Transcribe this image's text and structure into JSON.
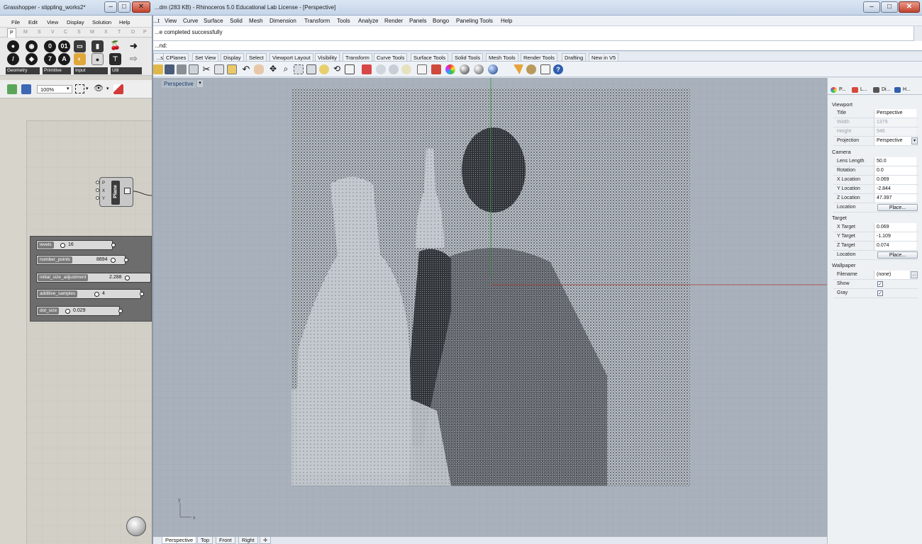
{
  "rhino": {
    "title": "...dm (283 KB) - Rhinoceros 5.0 Educational Lab License - [Perspective]",
    "menu": [
      "...t",
      "View",
      "Curve",
      "Surface",
      "Solid",
      "Mesh",
      "Dimension",
      "Transform",
      "Tools",
      "Analyze",
      "Render",
      "Panels",
      "Bongo",
      "Paneling Tools",
      "Help"
    ],
    "command_history": "...e completed successfully",
    "command_prompt": "...nd:",
    "toolbar_tabs": [
      "...s",
      "CPlanes",
      "Set View",
      "Display",
      "Select",
      "Viewport Layout",
      "Visibility",
      "Transform",
      "Curve Tools",
      "Surface Tools",
      "Solid Tools",
      "Mesh Tools",
      "Render Tools",
      "Drafting",
      "New in V5"
    ],
    "toolbar_icons": [
      "open-icon",
      "save-icon",
      "print-icon",
      "import-icon",
      "cut-icon",
      "copy-icon",
      "paste-icon",
      "undo-icon",
      "pan-icon",
      "move-icon",
      "zoom-icon",
      "zoom-window-icon",
      "zoom-extents-icon",
      "zoom-selected-icon",
      "rotate-view-icon",
      "four-viewports-icon",
      "show-points-icon",
      "hide-icon",
      "lock-icon",
      "lightbulb-icon",
      "layer-icon",
      "material-icon",
      "color-icon",
      "render-icon",
      "shaded-icon",
      "rendered-icon",
      "filter-icon",
      "settings-icon",
      "grid-snap-icon",
      "help-icon"
    ],
    "viewport": {
      "label": "Perspective",
      "tabs": [
        "Perspective",
        "Top",
        "Front",
        "Right"
      ],
      "axis_y": "y",
      "axis_x": "x"
    },
    "properties": {
      "tabs": [
        "P...",
        "L...",
        "Di...",
        "H..."
      ],
      "viewport_section": "Viewport",
      "title_label": "Title",
      "title_value": "Perspective",
      "width_label": "Width",
      "width_value": "1379",
      "height_label": "Height",
      "height_value": "946",
      "projection_label": "Projection",
      "projection_value": "Perspective",
      "camera_section": "Camera",
      "lens_label": "Lens Length",
      "lens_value": "50.0",
      "rotation_label": "Rotation",
      "rotation_value": "0.0",
      "xloc_label": "X Location",
      "xloc_value": "0.069",
      "yloc_label": "Y Location",
      "yloc_value": "-2.844",
      "zloc_label": "Z Location",
      "zloc_value": "47.397",
      "location_label": "Location",
      "place_label": "Place...",
      "target_section": "Target",
      "xt_label": "X Target",
      "xt_value": "0.069",
      "yt_label": "Y Target",
      "yt_value": "-1.109",
      "zt_label": "Z Target",
      "zt_value": "0.074",
      "tloc_label": "Location",
      "tplace_label": "Place...",
      "wallpaper_section": "Wallpaper",
      "filename_label": "Filename",
      "filename_value": "(none)",
      "show_label": "Show",
      "show_checked": true,
      "gray_label": "Gray",
      "gray_checked": true
    }
  },
  "grasshopper": {
    "title": "Grasshopper - stippling_works2*",
    "menu": [
      "File",
      "Edit",
      "View",
      "Display",
      "Solution",
      "Help"
    ],
    "category_tabs": [
      "P",
      "M",
      "S",
      "V",
      "C",
      "S",
      "M",
      "X",
      "T",
      "D",
      "P"
    ],
    "ribbon_groups": [
      "Geometry",
      "Primitive",
      "Input",
      "Util"
    ],
    "zoom": "100%",
    "plane_component": {
      "name": "Plane",
      "inputs": [
        "P",
        "X",
        "Y"
      ]
    },
    "sliders": [
      {
        "name": "levels",
        "value": "16"
      },
      {
        "name": "number_points",
        "value": "8894"
      },
      {
        "name": "initial_size_adjustment",
        "value": "2.288"
      },
      {
        "name": "additive_samples",
        "value": "4"
      },
      {
        "name": "dot_size",
        "value": "0.029"
      }
    ]
  }
}
